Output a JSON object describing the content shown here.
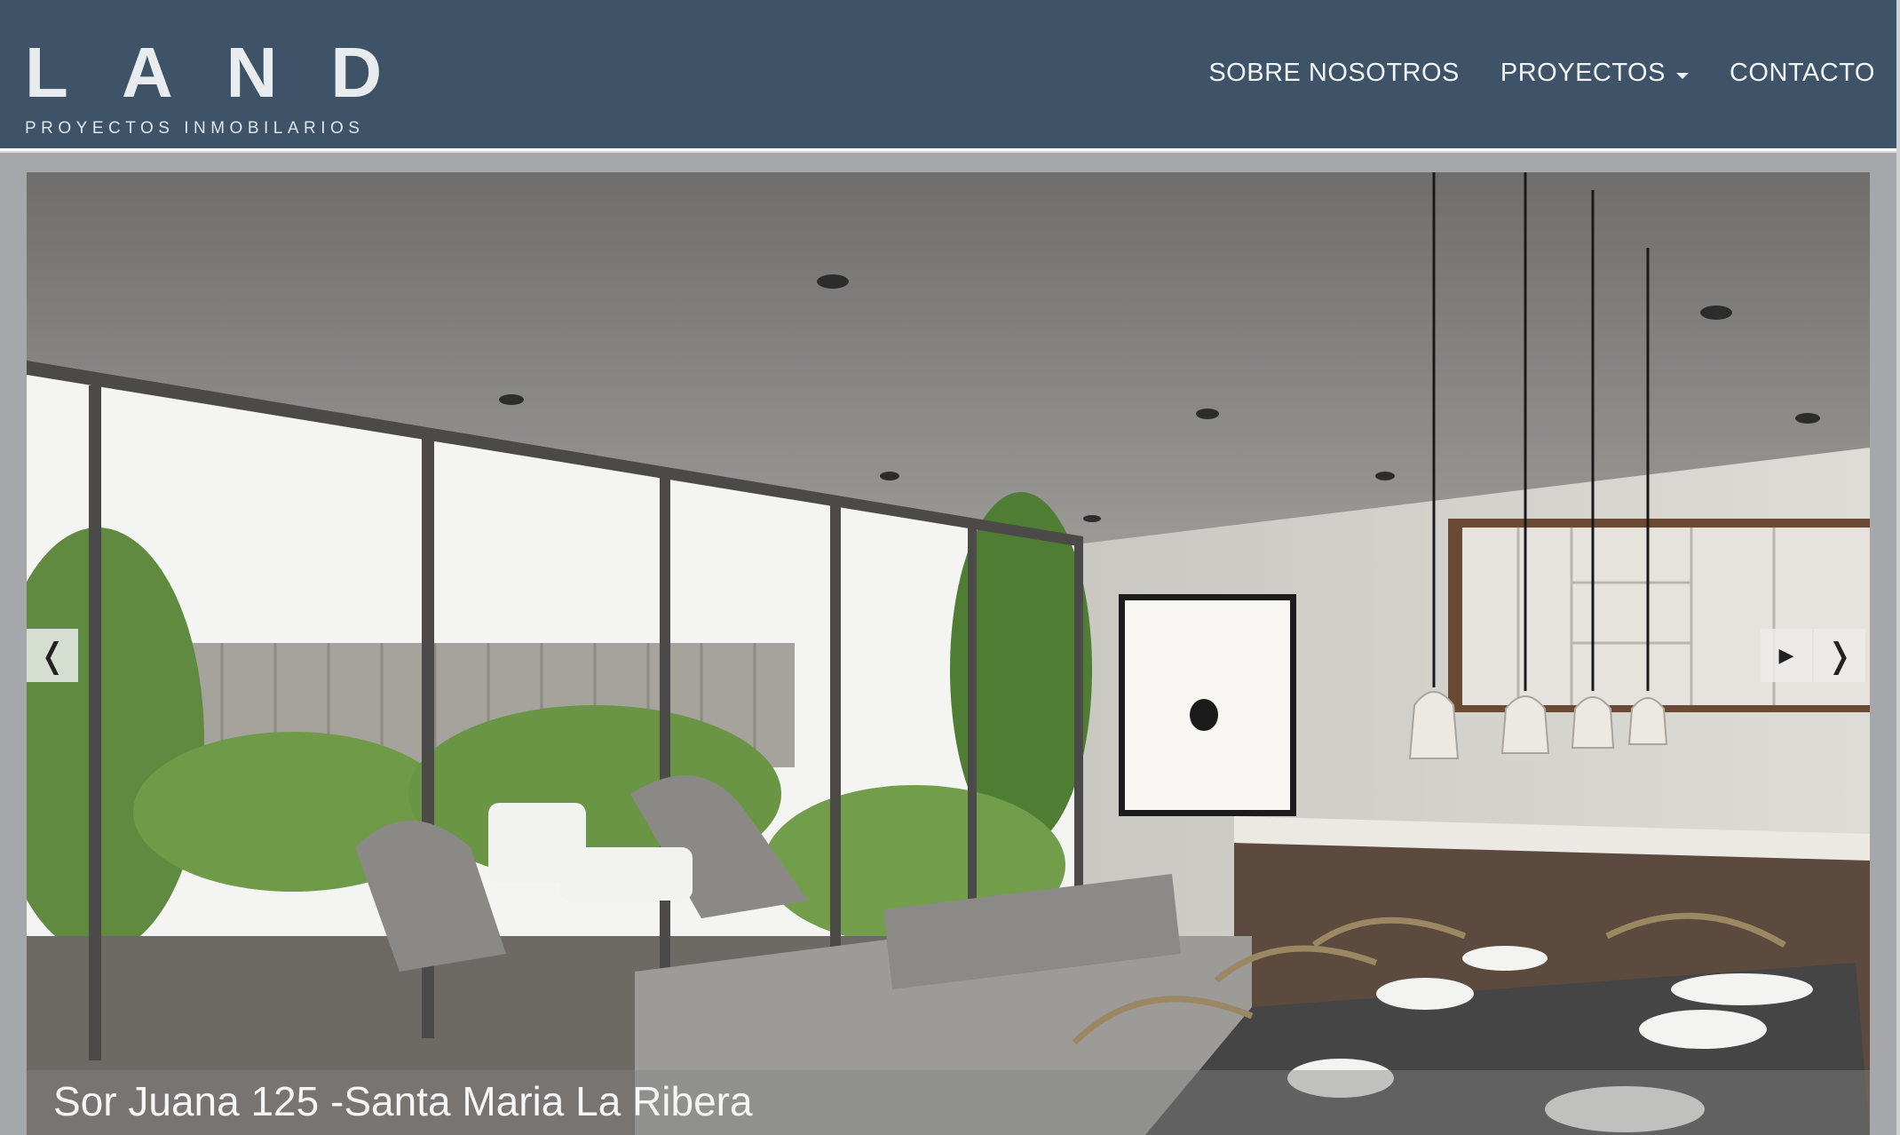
{
  "header": {
    "logo_text": "LAND",
    "logo_subtitle": "PROYECTOS INMOBILARIOS",
    "nav": [
      {
        "label": "SOBRE NOSOTROS"
      },
      {
        "label": "PROYECTOS"
      },
      {
        "label": "CONTACTO"
      }
    ]
  },
  "slider": {
    "caption": "Sor Juana 125 -Santa Maria La Ribera",
    "prev_symbol": "❬",
    "play_symbol": "▶",
    "next_symbol": "❭"
  },
  "colors": {
    "header_bg": "#3e5367",
    "frame_bg": "#a5a7aa"
  },
  "icons": [
    "chevron-left-icon",
    "play-icon",
    "chevron-right-icon",
    "caret-down-icon"
  ]
}
